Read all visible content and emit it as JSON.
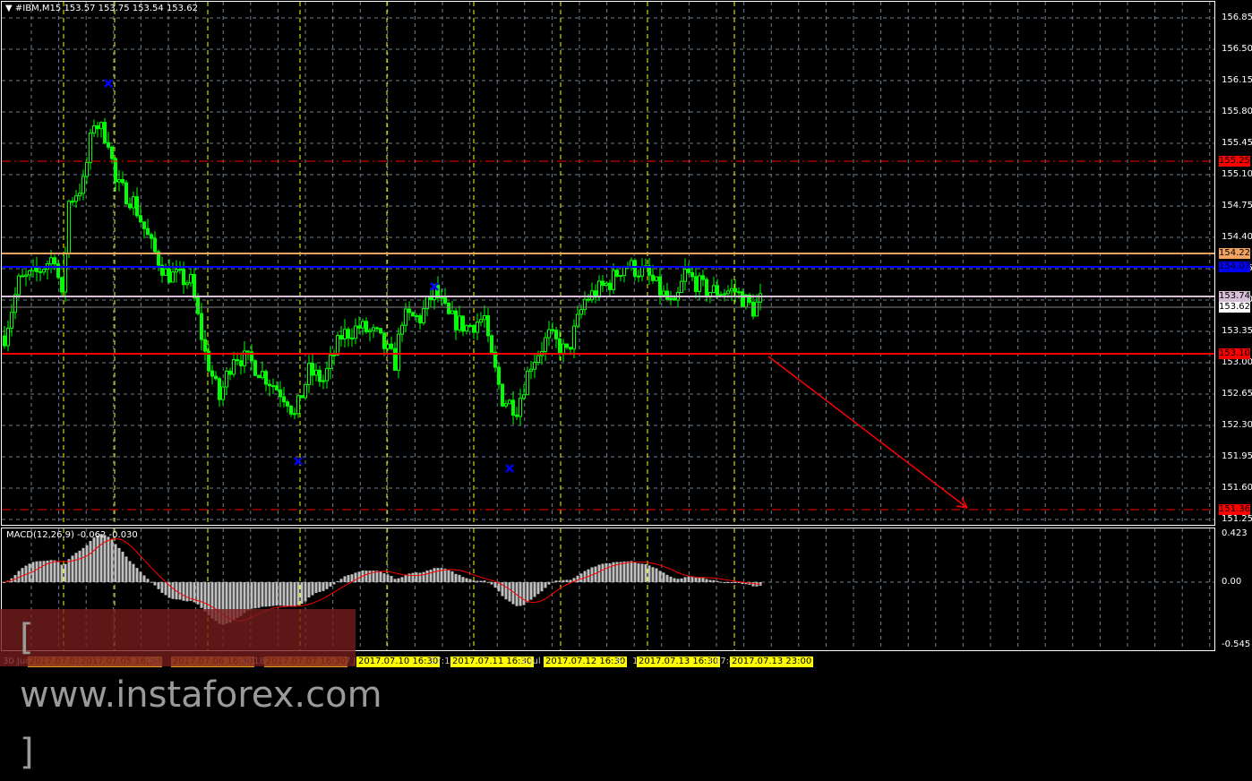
{
  "header": {
    "symbol": "#IBM,M15",
    "ohlc": "153.57 153.75 153.54 153.62",
    "menu_icon": "triangle-down-icon"
  },
  "price_axis": {
    "ticks": [
      "156.85",
      "156.50",
      "156.15",
      "155.80",
      "155.45",
      "155.10",
      "154.75",
      "154.40",
      "154.05",
      "153.70",
      "153.35",
      "153.00",
      "152.65",
      "152.30",
      "151.95",
      "151.60",
      "151.25"
    ],
    "tick_values": [
      156.85,
      156.5,
      156.15,
      155.8,
      155.45,
      155.1,
      154.75,
      154.4,
      154.05,
      153.7,
      153.35,
      153.0,
      152.65,
      152.3,
      151.95,
      151.6,
      151.25
    ],
    "range": [
      151.25,
      156.85
    ]
  },
  "levels": [
    {
      "label": "155.25",
      "value": 155.25,
      "color": "#ff0000",
      "text": "#000000",
      "style": "dashdot"
    },
    {
      "label": "154.22",
      "value": 154.22,
      "color": "#f4a460",
      "text": "#000000",
      "style": "solid"
    },
    {
      "label": "154.07",
      "value": 154.07,
      "color": "#0000ff",
      "text": "#000000",
      "style": "solid"
    },
    {
      "label": "153.74",
      "value": 153.74,
      "color": "#d8bfd8",
      "text": "#000000",
      "style": "solid"
    },
    {
      "label": "153.62",
      "value": 153.62,
      "color": "#ffffff",
      "text": "#000000",
      "style": "thin"
    },
    {
      "label": "153.10",
      "value": 153.1,
      "color": "#ff0000",
      "text": "#000000",
      "style": "solid"
    },
    {
      "label": "151.36",
      "value": 151.36,
      "color": "#ff0000",
      "text": "#000000",
      "style": "dashdot"
    }
  ],
  "price_path": [
    [
      0,
      153.3
    ],
    [
      4,
      153.9
    ],
    [
      9,
      154.0
    ],
    [
      14,
      154.2
    ],
    [
      16,
      153.7
    ],
    [
      18,
      154.8
    ],
    [
      22,
      155.0
    ],
    [
      25,
      155.7
    ],
    [
      29,
      155.5
    ],
    [
      31,
      155.0
    ],
    [
      36,
      154.8
    ],
    [
      41,
      154.3
    ],
    [
      45,
      154.0
    ],
    [
      52,
      153.9
    ],
    [
      56,
      153.1
    ],
    [
      60,
      152.6
    ],
    [
      64,
      153.1
    ],
    [
      69,
      153.0
    ],
    [
      74,
      152.8
    ],
    [
      79,
      152.6
    ],
    [
      81,
      152.4
    ],
    [
      85,
      152.9
    ],
    [
      89,
      152.8
    ],
    [
      94,
      153.3
    ],
    [
      99,
      153.4
    ],
    [
      104,
      153.3
    ],
    [
      109,
      153.0
    ],
    [
      111,
      153.5
    ],
    [
      116,
      153.5
    ],
    [
      120,
      153.8
    ],
    [
      124,
      153.5
    ],
    [
      129,
      153.4
    ],
    [
      134,
      153.5
    ],
    [
      135,
      153.2
    ],
    [
      139,
      152.6
    ],
    [
      143,
      152.5
    ],
    [
      147,
      153.0
    ],
    [
      152,
      153.3
    ],
    [
      157,
      153.1
    ],
    [
      162,
      153.7
    ],
    [
      169,
      153.9
    ],
    [
      173,
      154.1
    ],
    [
      179,
      154.0
    ],
    [
      183,
      153.8
    ],
    [
      187,
      153.6
    ],
    [
      190,
      154.0
    ],
    [
      196,
      153.8
    ],
    [
      204,
      153.8
    ],
    [
      209,
      153.6
    ],
    [
      211,
      153.7
    ]
  ],
  "markers": [
    {
      "price": 156.12,
      "index": 29
    },
    {
      "price": 151.9,
      "index": 82
    },
    {
      "price": 153.85,
      "index": 120
    },
    {
      "price": 151.82,
      "index": 141
    }
  ],
  "forecast_arrow": {
    "from_price": 153.1,
    "to_price": 151.36,
    "color": "#ff0000"
  },
  "macd": {
    "label": "MACD(12,26,9) -0.062 -0.030",
    "ticks": [
      "0.423",
      "0.00",
      "-0.545"
    ],
    "range": [
      -0.545,
      0.423
    ]
  },
  "time_axis": [
    {
      "text": "30 Jun",
      "type": "plain"
    },
    {
      "text": "2017.07.03 1",
      "type": "o"
    },
    {
      "text": "2017.07.05 16:30",
      "type": "o"
    },
    {
      "text": "45",
      "type": "plain"
    },
    {
      "text": "2017.07.06 16:30",
      "type": "o"
    },
    {
      "text": "ul 18:1",
      "type": "plain"
    },
    {
      "text": "2017.07.07 16:30",
      "type": "o"
    },
    {
      "text": "7 J",
      "type": "plain"
    },
    {
      "text": "2017.07.10 16:30",
      "type": "y"
    },
    {
      "text": "17:15",
      "type": "plain"
    },
    {
      "text": "2017.07.11 16:30",
      "type": "y"
    },
    {
      "text": "1 Jul 1",
      "type": "plain"
    },
    {
      "text": "2017.07.12 16:30",
      "type": "y"
    },
    {
      "text": "5",
      "type": "plain"
    },
    {
      "text": "1",
      "type": "plain"
    },
    {
      "text": "2017.07.13 16:30",
      "type": "y"
    },
    {
      "text": "l 17:4",
      "type": "plain"
    },
    {
      "text": "2017.07.13 23:00",
      "type": "y"
    }
  ],
  "watermark": "[ www.instaforex.com ]",
  "colors": {
    "candle": "#00ff00",
    "grid": "#708090",
    "session": "#ffff00",
    "marker": "#0000ff",
    "signal": "#ff0000",
    "hist": "#c0c0c0"
  }
}
